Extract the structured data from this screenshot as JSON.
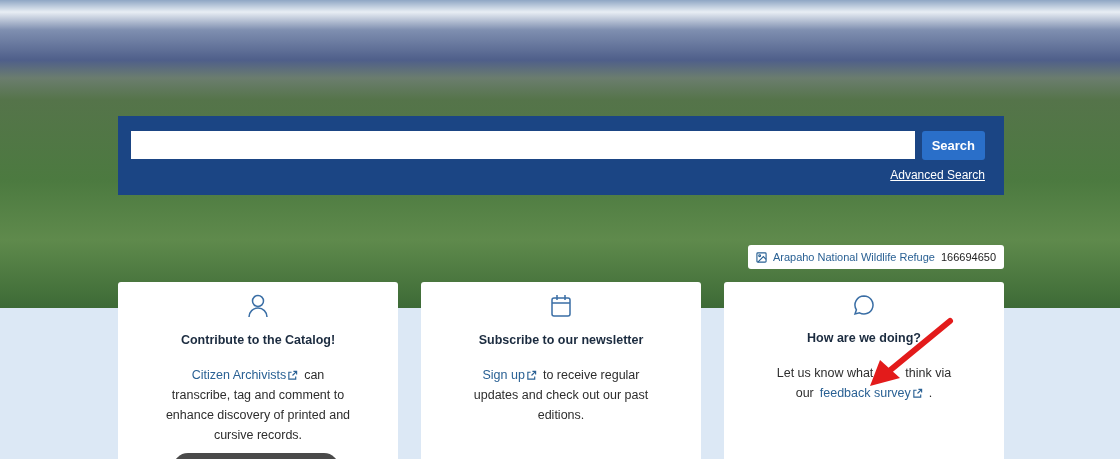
{
  "search": {
    "button": "Search",
    "advanced_link": "Advanced Search"
  },
  "photo_credit": {
    "title": "Arapaho National Wildlife Refuge",
    "id": "166694650"
  },
  "cards": [
    {
      "kind": "person",
      "heading": "Contribute to the Catalog!",
      "lines": [
        [
          {
            "text": "Citizen Archivists",
            "link": true
          },
          {
            "text": "can",
            "link": false
          }
        ],
        [
          {
            "text": "transcribe, tag and comment to",
            "link": false
          }
        ],
        [
          {
            "text": "enhance discovery of printed and",
            "link": false
          }
        ],
        [
          {
            "text": "cursive records.",
            "link": false
          }
        ]
      ],
      "cut_button": true
    },
    {
      "kind": "calendar",
      "heading": "Subscribe to our newsletter",
      "lines": [
        [
          {
            "text": "Sign up",
            "link": true
          },
          {
            "text": "to receive regular",
            "link": false
          }
        ],
        [
          {
            "text": "updates and check out our past",
            "link": false
          }
        ],
        [
          {
            "text": "editions.",
            "link": false
          }
        ]
      ],
      "cut_button": false
    },
    {
      "kind": "chat",
      "heading": "How are we doing?",
      "lines": [
        [
          {
            "text": "Let us know what",
            "link": false
          },
          {
            "text": "think via",
            "link": false,
            "gap": true
          }
        ],
        [
          {
            "text": "our",
            "link": false
          },
          {
            "text": "feedback survey",
            "link": true
          },
          {
            "text": ".",
            "link": false
          }
        ]
      ],
      "cut_button": false,
      "annotation": {
        "kind": "arrow"
      }
    }
  ]
}
